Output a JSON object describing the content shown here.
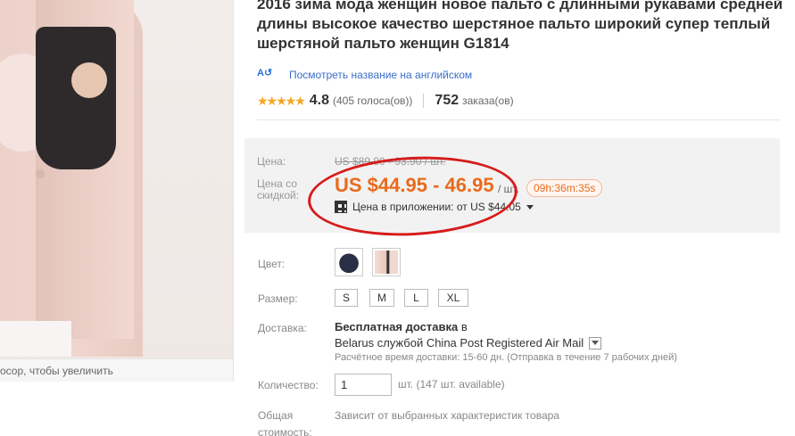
{
  "image": {
    "zoom_hint": "осор, чтобы увеличить"
  },
  "product": {
    "title": "2016 зима мода женщин новое пальто с длинными рукавами средней длины высокое качество шерстяное пальто широкий супер теплый шерстяной пальто женщин G1814",
    "translate_link": "Посмотреть название на английском",
    "translate_icon": "translate-icon",
    "rating": {
      "stars": "★★★★★",
      "value": "4.8",
      "votes": "(405 голоса(ов))"
    },
    "orders": {
      "count": "752",
      "label": "заказа(ов)"
    }
  },
  "price": {
    "label": "Цена:",
    "old_value": "US $89.90 - 93.90 / шт.",
    "discount_label_line1": "Цена со",
    "discount_label_line2": "скидкой:",
    "sale_value": "US $44.95 - 46.95",
    "per_unit": "/ шт.",
    "timer": "09h:36m:35s",
    "app_price": "Цена в приложении: от US $44.05",
    "accent_color": "#e96a1c"
  },
  "options": {
    "color_label": "Цвет:",
    "colors": [
      "navy",
      "pink"
    ],
    "size_label": "Размер:",
    "sizes": [
      "S",
      "M",
      "L",
      "XL"
    ]
  },
  "shipping": {
    "label": "Доставка:",
    "free": "Бесплатная доставка",
    "to": "в",
    "service": "Belarus службой China Post Registered Air Mail",
    "estimate": "Расчётное время доставки: 15-60 дн. (Отправка в течение 7 рабочих дней)"
  },
  "quantity": {
    "label": "Количество:",
    "value": "1",
    "available": "шт. (147 шт. available)"
  },
  "total": {
    "label_line1": "Общая",
    "label_line2": "стоимость:",
    "value": "Зависит от выбранных характеристик товара"
  }
}
